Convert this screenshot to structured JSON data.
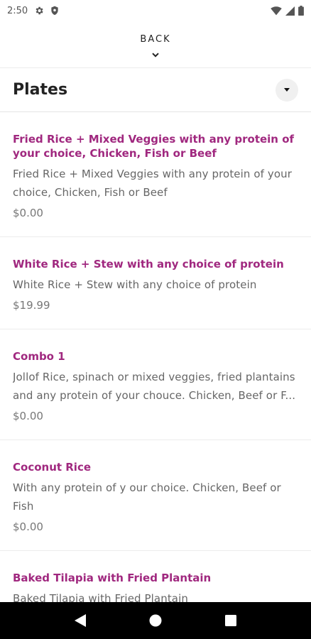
{
  "status_bar": {
    "time": "2:50"
  },
  "back": {
    "label": "BACK"
  },
  "category": {
    "title": "Plates"
  },
  "menu_items": [
    {
      "title": "Fried Rice + Mixed Veggies with any protein of your choice, Chicken, Fish or Beef",
      "description_lines": [
        "Fried Rice + Mixed Veggies with any protein of your",
        "choice, Chicken, Fish or Beef"
      ],
      "price": "$0.00"
    },
    {
      "title": "White Rice + Stew with any choice of protein",
      "description_lines": [
        "White Rice + Stew with any choice of protein"
      ],
      "price": "$19.99"
    },
    {
      "title": "Combo 1",
      "description_lines": [
        "Jollof Rice, spinach or mixed veggies, fried plantains",
        "and any protein of your chouce. Chicken, Beef or F..."
      ],
      "price": "$0.00"
    },
    {
      "title": "Coconut Rice",
      "description_lines": [
        "With any protein of y our choice. Chicken, Beef or",
        "Fish"
      ],
      "price": "$0.00"
    },
    {
      "title": "Baked Tilapia with Fried Plantain",
      "description_lines": [
        "Baked Tilapia with Fried Plantain"
      ],
      "price": ""
    }
  ],
  "colors": {
    "accent": "#a0287f",
    "nav_bg": "#000000"
  }
}
